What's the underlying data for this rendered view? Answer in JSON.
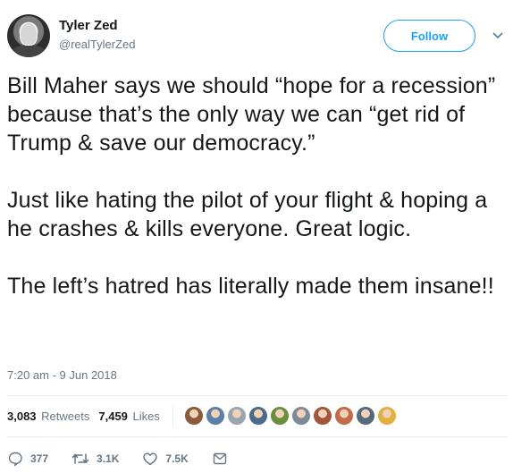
{
  "user": {
    "display_name": "Tyler Zed",
    "handle": "@realTylerZed"
  },
  "follow_label": "Follow",
  "tweet": {
    "paragraphs": [
      "Bill Maher says we should “hope for a recession” because that’s the only way we can “get rid of Trump & save our democracy.”",
      "Just like hating the pilot of your flight & hoping a he crashes & kills everyone. Great logic.",
      "The left’s hatred has literally made them insane!!"
    ],
    "timestamp": "7:20 am - 9 Jun 2018"
  },
  "stats": {
    "retweets_count": "3,083",
    "retweets_label": "Retweets",
    "likes_count": "7,459",
    "likes_label": "Likes",
    "liker_avatar_colors": [
      "#8b5a3c",
      "#5b7fa6",
      "#9aa5b1",
      "#4a6b8a",
      "#6b8e3a",
      "#7d8b99",
      "#a3543d",
      "#c26a4a",
      "#556b7d",
      "#e0b040"
    ]
  },
  "actions": {
    "reply_count": "377",
    "retweet_count": "3.1K",
    "like_count": "7.5K"
  },
  "colors": {
    "accent": "#1da1f2",
    "secondary_text": "#657786",
    "divider": "#e6ecf0"
  }
}
